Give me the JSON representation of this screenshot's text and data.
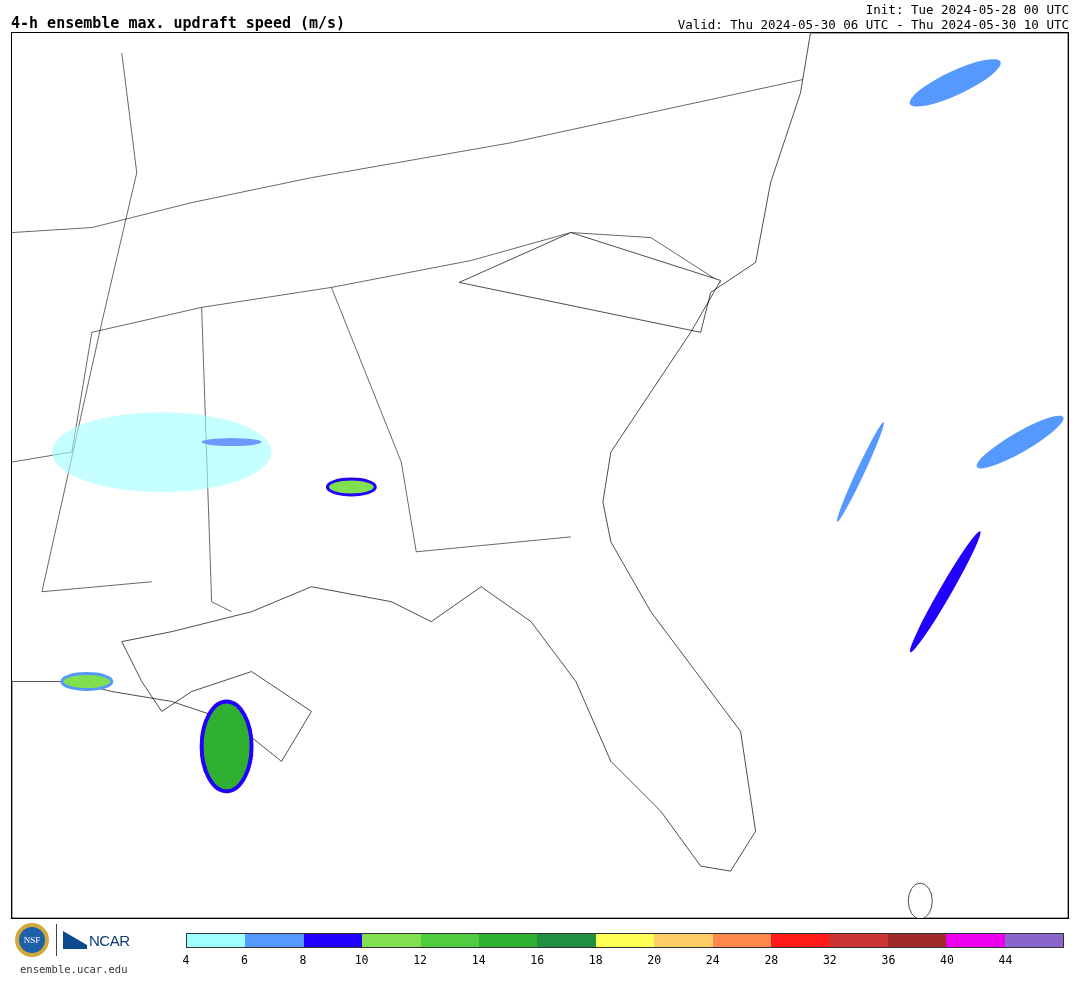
{
  "title": "4-h ensemble max. updraft speed (m/s)",
  "init": "Init: Tue 2024-05-28 00 UTC",
  "valid": "Valid: Thu 2024-05-30 06 UTC - Thu 2024-05-30 10 UTC",
  "footer": {
    "logo_text": "NCAR",
    "site": "ensemble.ucar.edu",
    "seal_text": "NSF"
  },
  "colorbar": {
    "bins": [
      {
        "color": "#a0ffff"
      },
      {
        "color": "#5599ff"
      },
      {
        "color": "#2200ff"
      },
      {
        "color": "#80e050"
      },
      {
        "color": "#50cc40"
      },
      {
        "color": "#30b030"
      },
      {
        "color": "#209040"
      },
      {
        "color": "#ffff55"
      },
      {
        "color": "#ffcc66"
      },
      {
        "color": "#ff884d"
      },
      {
        "color": "#ff1a1a"
      },
      {
        "color": "#cc3333"
      },
      {
        "color": "#a02a2a"
      },
      {
        "color": "#ee00ee"
      },
      {
        "color": "#8866cc"
      }
    ],
    "ticks": [
      "4",
      "6",
      "8",
      "10",
      "12",
      "14",
      "16",
      "18",
      "20",
      "24",
      "28",
      "32",
      "36",
      "40",
      "44"
    ]
  }
}
